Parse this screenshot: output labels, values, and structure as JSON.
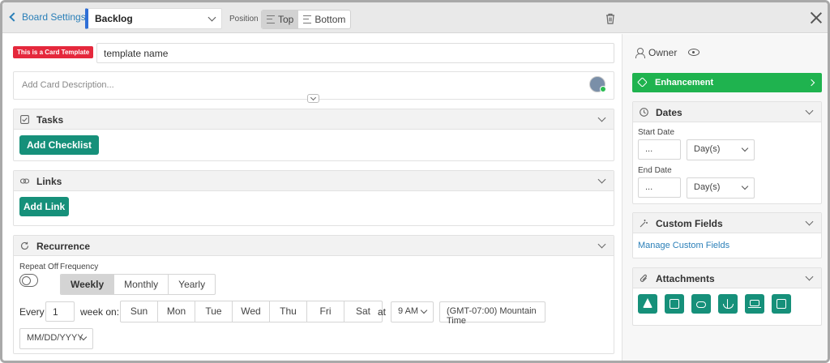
{
  "topbar": {
    "back_label": "Board Settings",
    "column_select": "Backlog",
    "position_label": "Position",
    "position_top": "Top",
    "position_bottom": "Bottom",
    "position_selected": "Top"
  },
  "card": {
    "template_badge": "This is a Card Template",
    "template_name": "template name",
    "description_placeholder": "Add Card Description..."
  },
  "tasks": {
    "title": "Tasks",
    "add_button": "Add Checklist"
  },
  "links": {
    "title": "Links",
    "add_button": "Add Link"
  },
  "recurrence": {
    "title": "Recurrence",
    "repeat_label": "Repeat Off",
    "frequency_label": "Frequency",
    "frequencies": [
      "Weekly",
      "Monthly",
      "Yearly"
    ],
    "selected_frequency": "Weekly",
    "every_label": "Every",
    "every_value": "1",
    "week_on_label": "week on:",
    "days": [
      "Sun",
      "Mon",
      "Tue",
      "Wed",
      "Thu",
      "Fri",
      "Sat"
    ],
    "at_label": "at",
    "time_value": "9 AM",
    "timezone": "(GMT-07:00) Mountain Time",
    "date_format": "MM/DD/YYYY"
  },
  "sidebar": {
    "owner_label": "Owner",
    "label_button": "Enhancement",
    "label_color": "#1fb34f",
    "dates": {
      "title": "Dates",
      "start_label": "Start Date",
      "start_value": "...",
      "start_unit": "Day(s)",
      "end_label": "End Date",
      "end_value": "...",
      "end_unit": "Day(s)"
    },
    "custom_fields": {
      "title": "Custom Fields",
      "manage_link": "Manage Custom Fields"
    },
    "attachments": {
      "title": "Attachments",
      "icons": [
        "google-drive-icon",
        "dropbox-icon",
        "onedrive-icon",
        "anchor-icon",
        "computer-icon",
        "copy-icon"
      ]
    }
  },
  "colors": {
    "accent_teal": "#16907a",
    "template_red": "#e5283c",
    "link_blue": "#2a7fb8"
  }
}
